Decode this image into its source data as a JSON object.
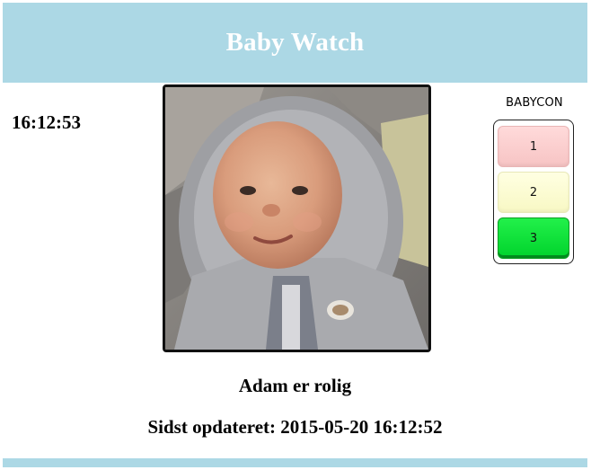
{
  "header": {
    "title": "Baby Watch"
  },
  "clock": {
    "time": "16:12:53"
  },
  "photo": {
    "subject": "baby-photo"
  },
  "babycon": {
    "label": "BABYCON",
    "levels": [
      {
        "label": "1",
        "color": "#fcd2d2"
      },
      {
        "label": "2",
        "color": "#fbfbd2"
      },
      {
        "label": "3",
        "color": "#11e23b"
      }
    ],
    "active_level": "3"
  },
  "status": {
    "text": "Adam er rolig"
  },
  "updated": {
    "text": "Sidst opdateret: 2015-05-20 16:12:52"
  },
  "colors": {
    "header_bg": "#acd8e5",
    "header_text": "#ffffff",
    "footer_bg": "#acd8e5"
  }
}
